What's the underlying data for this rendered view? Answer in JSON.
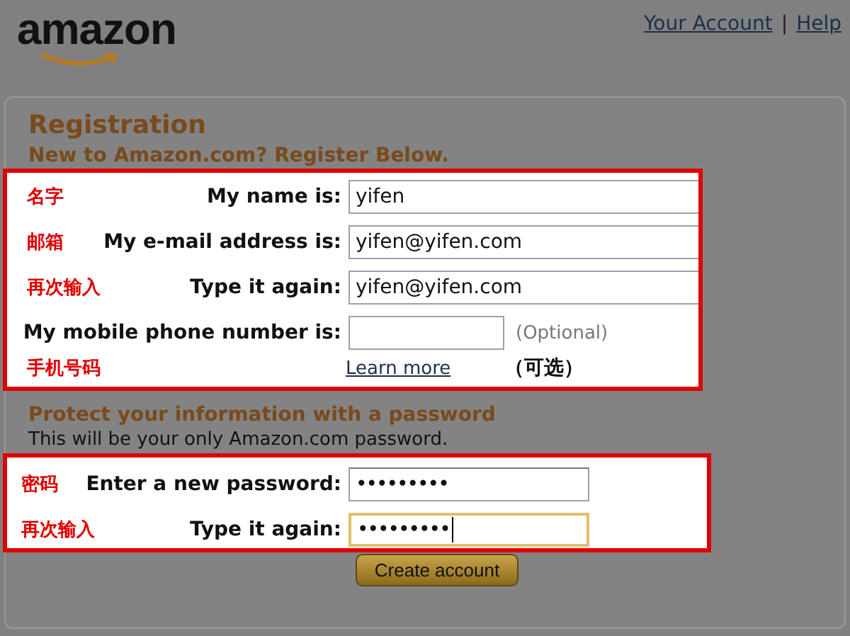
{
  "header": {
    "logo": "amazon",
    "links": [
      {
        "label": "Your Account"
      },
      {
        "label": "Help"
      }
    ],
    "separator": "|"
  },
  "registration": {
    "title": "Registration",
    "subtitle": "New to Amazon.com? Register Below.",
    "fields": [
      {
        "note": "名字",
        "label": "My name is:",
        "value": "yifen"
      },
      {
        "note": "邮箱",
        "label": "My e-mail address is:",
        "value": "yifen@yifen.com"
      },
      {
        "note": "再次输入",
        "label": "Type it again:",
        "value": "yifen@yifen.com"
      }
    ],
    "mobile": {
      "label": "My mobile phone number is:",
      "hint": "(Optional)",
      "note": "手机号码",
      "link": "Learn more",
      "hint_note": "（可选）"
    }
  },
  "password": {
    "title": "Protect your information with a password",
    "description": "This will be your only Amazon.com password.",
    "fields": [
      {
        "note": "密码",
        "label": "Enter a new password:",
        "value": "•••••••••",
        "focused": false
      },
      {
        "note": "再次输入",
        "label": "Type it again:",
        "value": "•••••••••",
        "focused": true
      }
    ]
  },
  "button": "Create account"
}
